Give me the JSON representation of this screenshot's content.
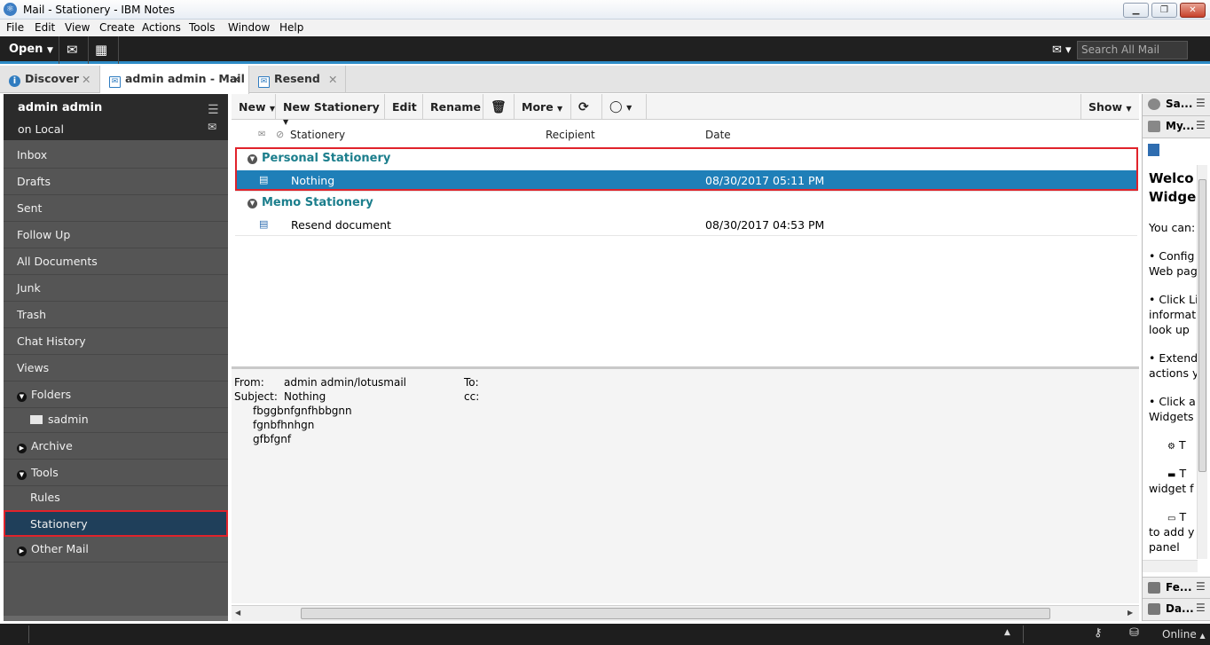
{
  "window": {
    "title": "Mail - Stationery - IBM Notes"
  },
  "menu": [
    "File",
    "Edit",
    "View",
    "Create",
    "Actions",
    "Tools",
    "Window",
    "Help"
  ],
  "toolbar": {
    "open_label": "Open",
    "search_placeholder": "Search All Mail"
  },
  "tabs": [
    {
      "label": "Discover"
    },
    {
      "label": "admin admin - Mail"
    },
    {
      "label": "Resend"
    }
  ],
  "sidebar": {
    "user": "admin admin",
    "location": "on Local",
    "items": [
      "Inbox",
      "Drafts",
      "Sent",
      "Follow Up",
      "All Documents",
      "Junk",
      "Trash",
      "Chat History",
      "Views"
    ],
    "folders_label": "Folders",
    "folder_item": "sadmin",
    "archive_label": "Archive",
    "tools_label": "Tools",
    "tools_items": [
      "Rules",
      "Stationery"
    ],
    "other_mail_label": "Other Mail"
  },
  "actions": {
    "new": "New",
    "new_stationery": "New Stationery",
    "edit": "Edit",
    "rename": "Rename",
    "more": "More",
    "show": "Show"
  },
  "columns": {
    "stationery": "Stationery",
    "recipient": "Recipient",
    "date": "Date"
  },
  "categories": [
    {
      "name": "Personal Stationery",
      "rows": [
        {
          "stationery": "Nothing",
          "recipient": "",
          "date": "08/30/2017 05:11 PM",
          "selected": true
        }
      ]
    },
    {
      "name": "Memo Stationery",
      "rows": [
        {
          "stationery": "Resend document",
          "recipient": "",
          "date": "08/30/2017 04:53 PM",
          "selected": false
        }
      ]
    }
  ],
  "preview": {
    "from_label": "From:",
    "from_value": "admin admin/lotusmail",
    "to_label": "To:",
    "subject_label": "Subject:",
    "subject_value": "Nothing",
    "cc_label": "cc:",
    "body": [
      "fbggbnfgnfhbbgnn",
      "fgnbfhnhgn",
      "gfbfgnf"
    ]
  },
  "right_panel": {
    "head1": "Sa...",
    "head2": "My...",
    "welcome_title_1": "Welco",
    "welcome_title_2": "Widge",
    "lines": [
      "You can:",
      "• Config",
      "Web pag",
      "• Click Li",
      "informat",
      "look up",
      "• Extend",
      "actions y",
      "• Click a",
      "Widgets",
      "T",
      "T",
      "widget f",
      "T",
      "to add y",
      "panel"
    ],
    "feeds": "Fe...",
    "day": "Da..."
  },
  "status": {
    "online": "Online"
  }
}
